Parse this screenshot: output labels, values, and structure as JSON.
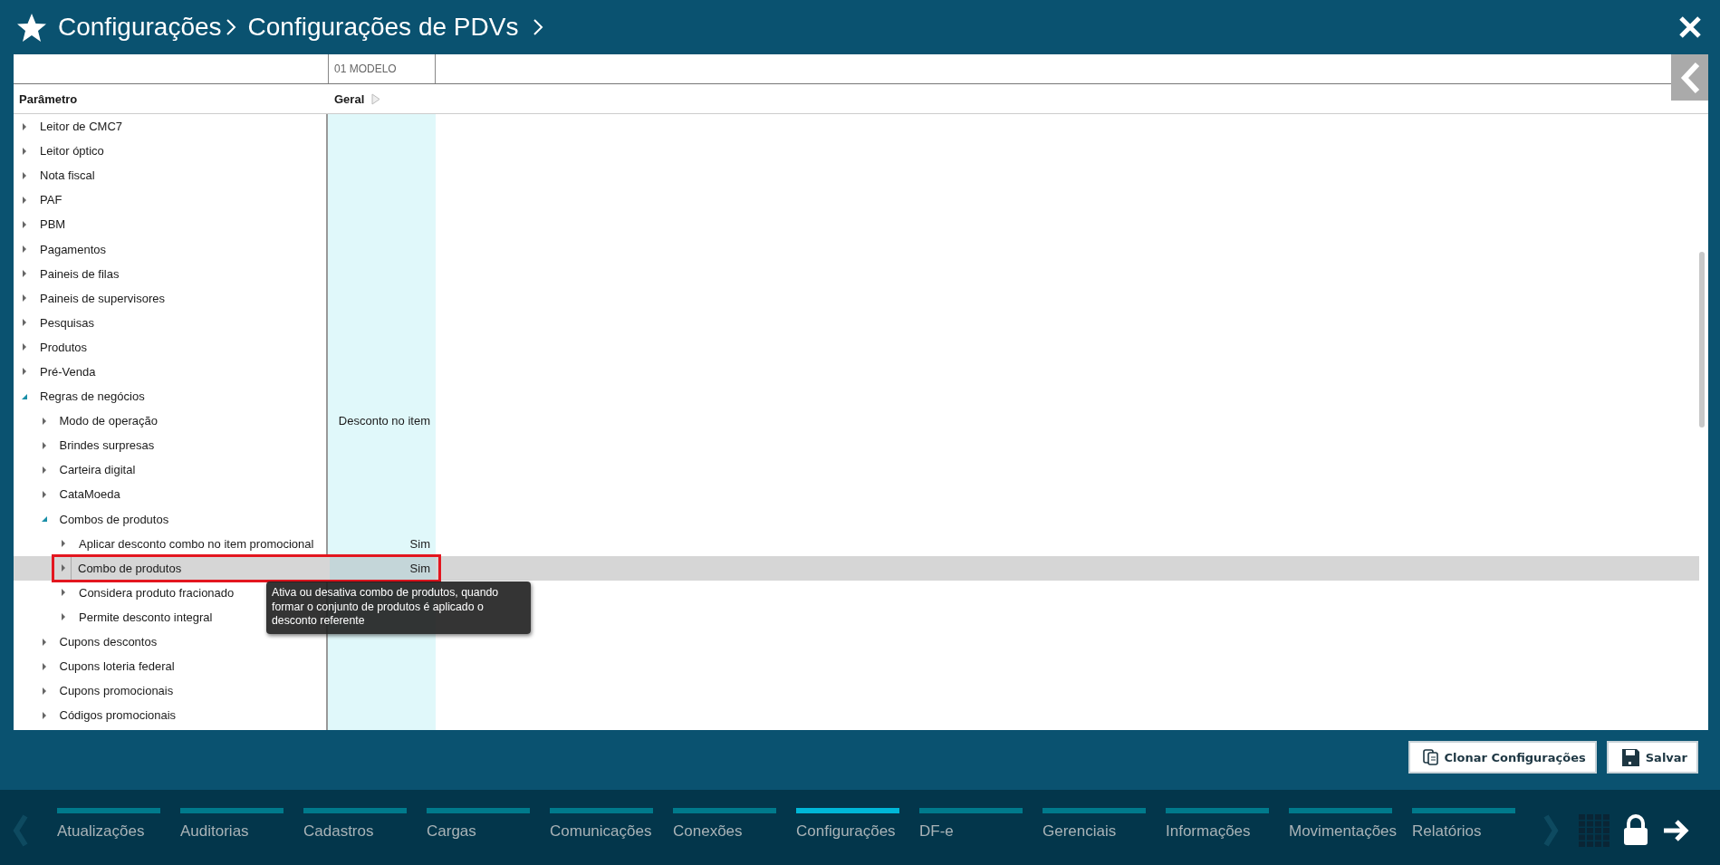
{
  "header": {
    "breadcrumb": [
      "Configurações",
      "Configurações de PDVs"
    ]
  },
  "table": {
    "model_label": "01 MODELO",
    "columns": [
      "Parâmetro",
      "Geral"
    ],
    "rows": [
      {
        "label": "Leitor de CMC7",
        "expanded": false,
        "selected": false
      },
      {
        "label": "Leitor óptico",
        "expanded": false,
        "selected": false
      },
      {
        "label": "Nota fiscal",
        "expanded": false,
        "selected": false
      },
      {
        "label": "PAF",
        "expanded": false,
        "selected": false
      },
      {
        "label": "PBM",
        "expanded": false,
        "selected": false
      },
      {
        "label": "Pagamentos",
        "expanded": false,
        "selected": false
      },
      {
        "label": "Paineis de filas",
        "expanded": false,
        "selected": false
      },
      {
        "label": "Paineis de supervisores",
        "expanded": false,
        "selected": false
      },
      {
        "label": "Pesquisas",
        "expanded": false,
        "selected": false
      },
      {
        "label": "Produtos",
        "expanded": false,
        "selected": false
      },
      {
        "label": "Pré-Venda",
        "expanded": false,
        "selected": false
      },
      {
        "label": "Regras de negócios",
        "expanded": true,
        "selected": false,
        "children": [
          {
            "label": "Modo de operação",
            "value": "Desconto no item",
            "expanded": false,
            "selected": false
          },
          {
            "label": "Brindes surpresas",
            "expanded": false,
            "selected": false
          },
          {
            "label": "Carteira digital",
            "expanded": false,
            "selected": false
          },
          {
            "label": "CataMoeda",
            "expanded": false,
            "selected": false
          },
          {
            "label": "Combos de produtos",
            "expanded": true,
            "selected": false,
            "children": [
              {
                "label": "Aplicar desconto combo no item promocional",
                "value": "Sim",
                "expanded": false,
                "selected": false
              },
              {
                "label": "Combo de produtos",
                "value": "Sim",
                "expanded": false,
                "selected": true,
                "outlined": true
              },
              {
                "label": "Considera produto fracionado",
                "expanded": false,
                "selected": false
              },
              {
                "label": "Permite desconto integral",
                "expanded": false,
                "selected": false
              }
            ]
          },
          {
            "label": "Cupons descontos",
            "expanded": false,
            "selected": false
          },
          {
            "label": "Cupons loteria federal",
            "expanded": false,
            "selected": false
          },
          {
            "label": "Cupons promocionais",
            "expanded": false,
            "selected": false
          },
          {
            "label": "Códigos promocionais",
            "expanded": false,
            "selected": false
          }
        ]
      }
    ],
    "tooltip": "Ativa ou desativa combo de produtos, quando formar o conjunto de produtos é aplicado o desconto referente"
  },
  "buttons": [
    {
      "label": "Clonar Configurações",
      "kind": "clone"
    },
    {
      "label": "Salvar",
      "kind": "save"
    }
  ],
  "nav": {
    "tabs": [
      {
        "label": "Atualizações",
        "selected": false
      },
      {
        "label": "Auditorias",
        "selected": false
      },
      {
        "label": "Cadastros",
        "selected": false
      },
      {
        "label": "Cargas",
        "selected": false
      },
      {
        "label": "Comunicações",
        "selected": false
      },
      {
        "label": "Conexões",
        "selected": false
      },
      {
        "label": "Configurações",
        "selected": true
      },
      {
        "label": "DF-e",
        "selected": false
      },
      {
        "label": "Gerenciais",
        "selected": false
      },
      {
        "label": "Informações",
        "selected": false
      },
      {
        "label": "Movimentações",
        "selected": false
      },
      {
        "label": "Relatórios",
        "selected": false
      }
    ]
  }
}
